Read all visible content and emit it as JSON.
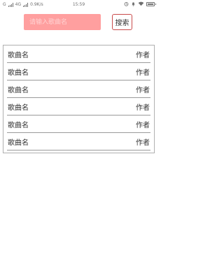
{
  "status_bar": {
    "network": "G",
    "network_type": "4G",
    "speed": "0.9K/s",
    "time": "15:59"
  },
  "search": {
    "placeholder": "请输入歌曲名",
    "value": "",
    "button_label": "搜索",
    "accent_color": "#ff9f9f"
  },
  "songs": [
    {
      "title": "歌曲名",
      "artist": "作者"
    },
    {
      "title": "歌曲名",
      "artist": "作者"
    },
    {
      "title": "歌曲名",
      "artist": "作者"
    },
    {
      "title": "歌曲名",
      "artist": "作者"
    },
    {
      "title": "歌曲名",
      "artist": "作者"
    },
    {
      "title": "歌曲名",
      "artist": "作者"
    }
  ]
}
